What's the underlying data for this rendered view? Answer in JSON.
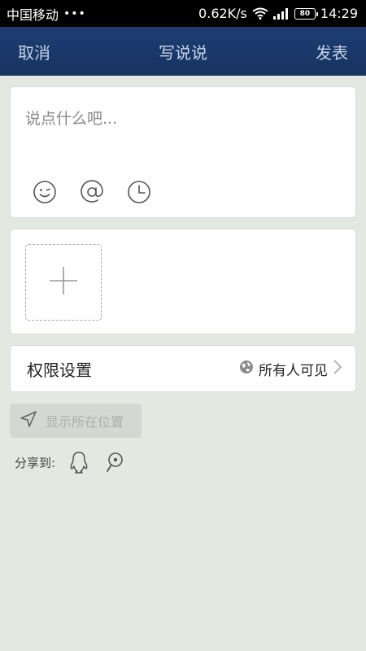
{
  "status_bar": {
    "carrier": "中国移动",
    "dots": "•••",
    "speed": "0.62K/s",
    "battery": "80",
    "time": "14:29"
  },
  "nav": {
    "cancel": "取消",
    "title": "写说说",
    "publish": "发表"
  },
  "compose": {
    "placeholder": "说点什么吧...",
    "tools": [
      "emoji-icon",
      "at-icon",
      "clock-icon"
    ]
  },
  "photos": {
    "add_icon": "plus-icon"
  },
  "permission": {
    "label": "权限设置",
    "value": "所有人可见"
  },
  "location": {
    "label": "显示所在位置"
  },
  "share": {
    "label": "分享到:",
    "targets": [
      "qq-icon",
      "weibo-icon"
    ]
  },
  "colors": {
    "navbar": "#17335f",
    "nav_text": "#c5d3ea",
    "background": "#e3e9e1",
    "card": "#ffffff",
    "location_bg": "#d4d8d3"
  }
}
